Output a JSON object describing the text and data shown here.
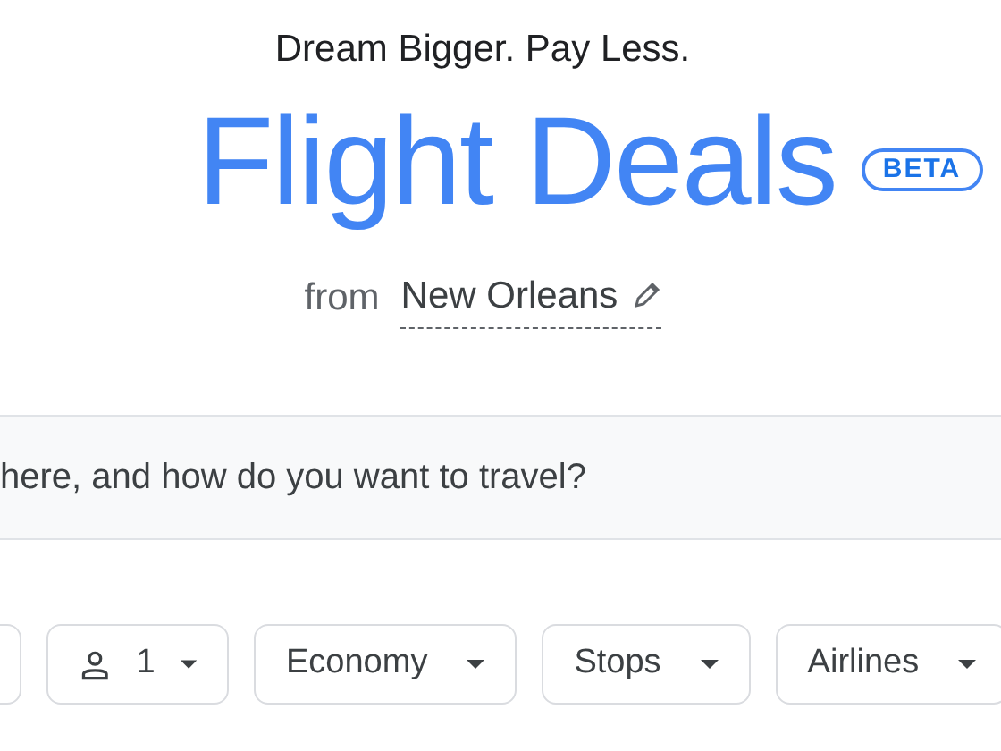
{
  "tagline": "Dream Bigger. Pay Less.",
  "title": "Flight Deals",
  "badge": "BETA",
  "origin": {
    "prefix": "from",
    "city": "New Orleans"
  },
  "search": {
    "placeholder": "here, and how do you want to travel?"
  },
  "filters": [
    {
      "kind": "blank"
    },
    {
      "kind": "passengers",
      "label": "1"
    },
    {
      "kind": "dropdown",
      "label": "Economy"
    },
    {
      "kind": "dropdown",
      "label": "Stops"
    },
    {
      "kind": "dropdown",
      "label": "Airlines"
    }
  ]
}
